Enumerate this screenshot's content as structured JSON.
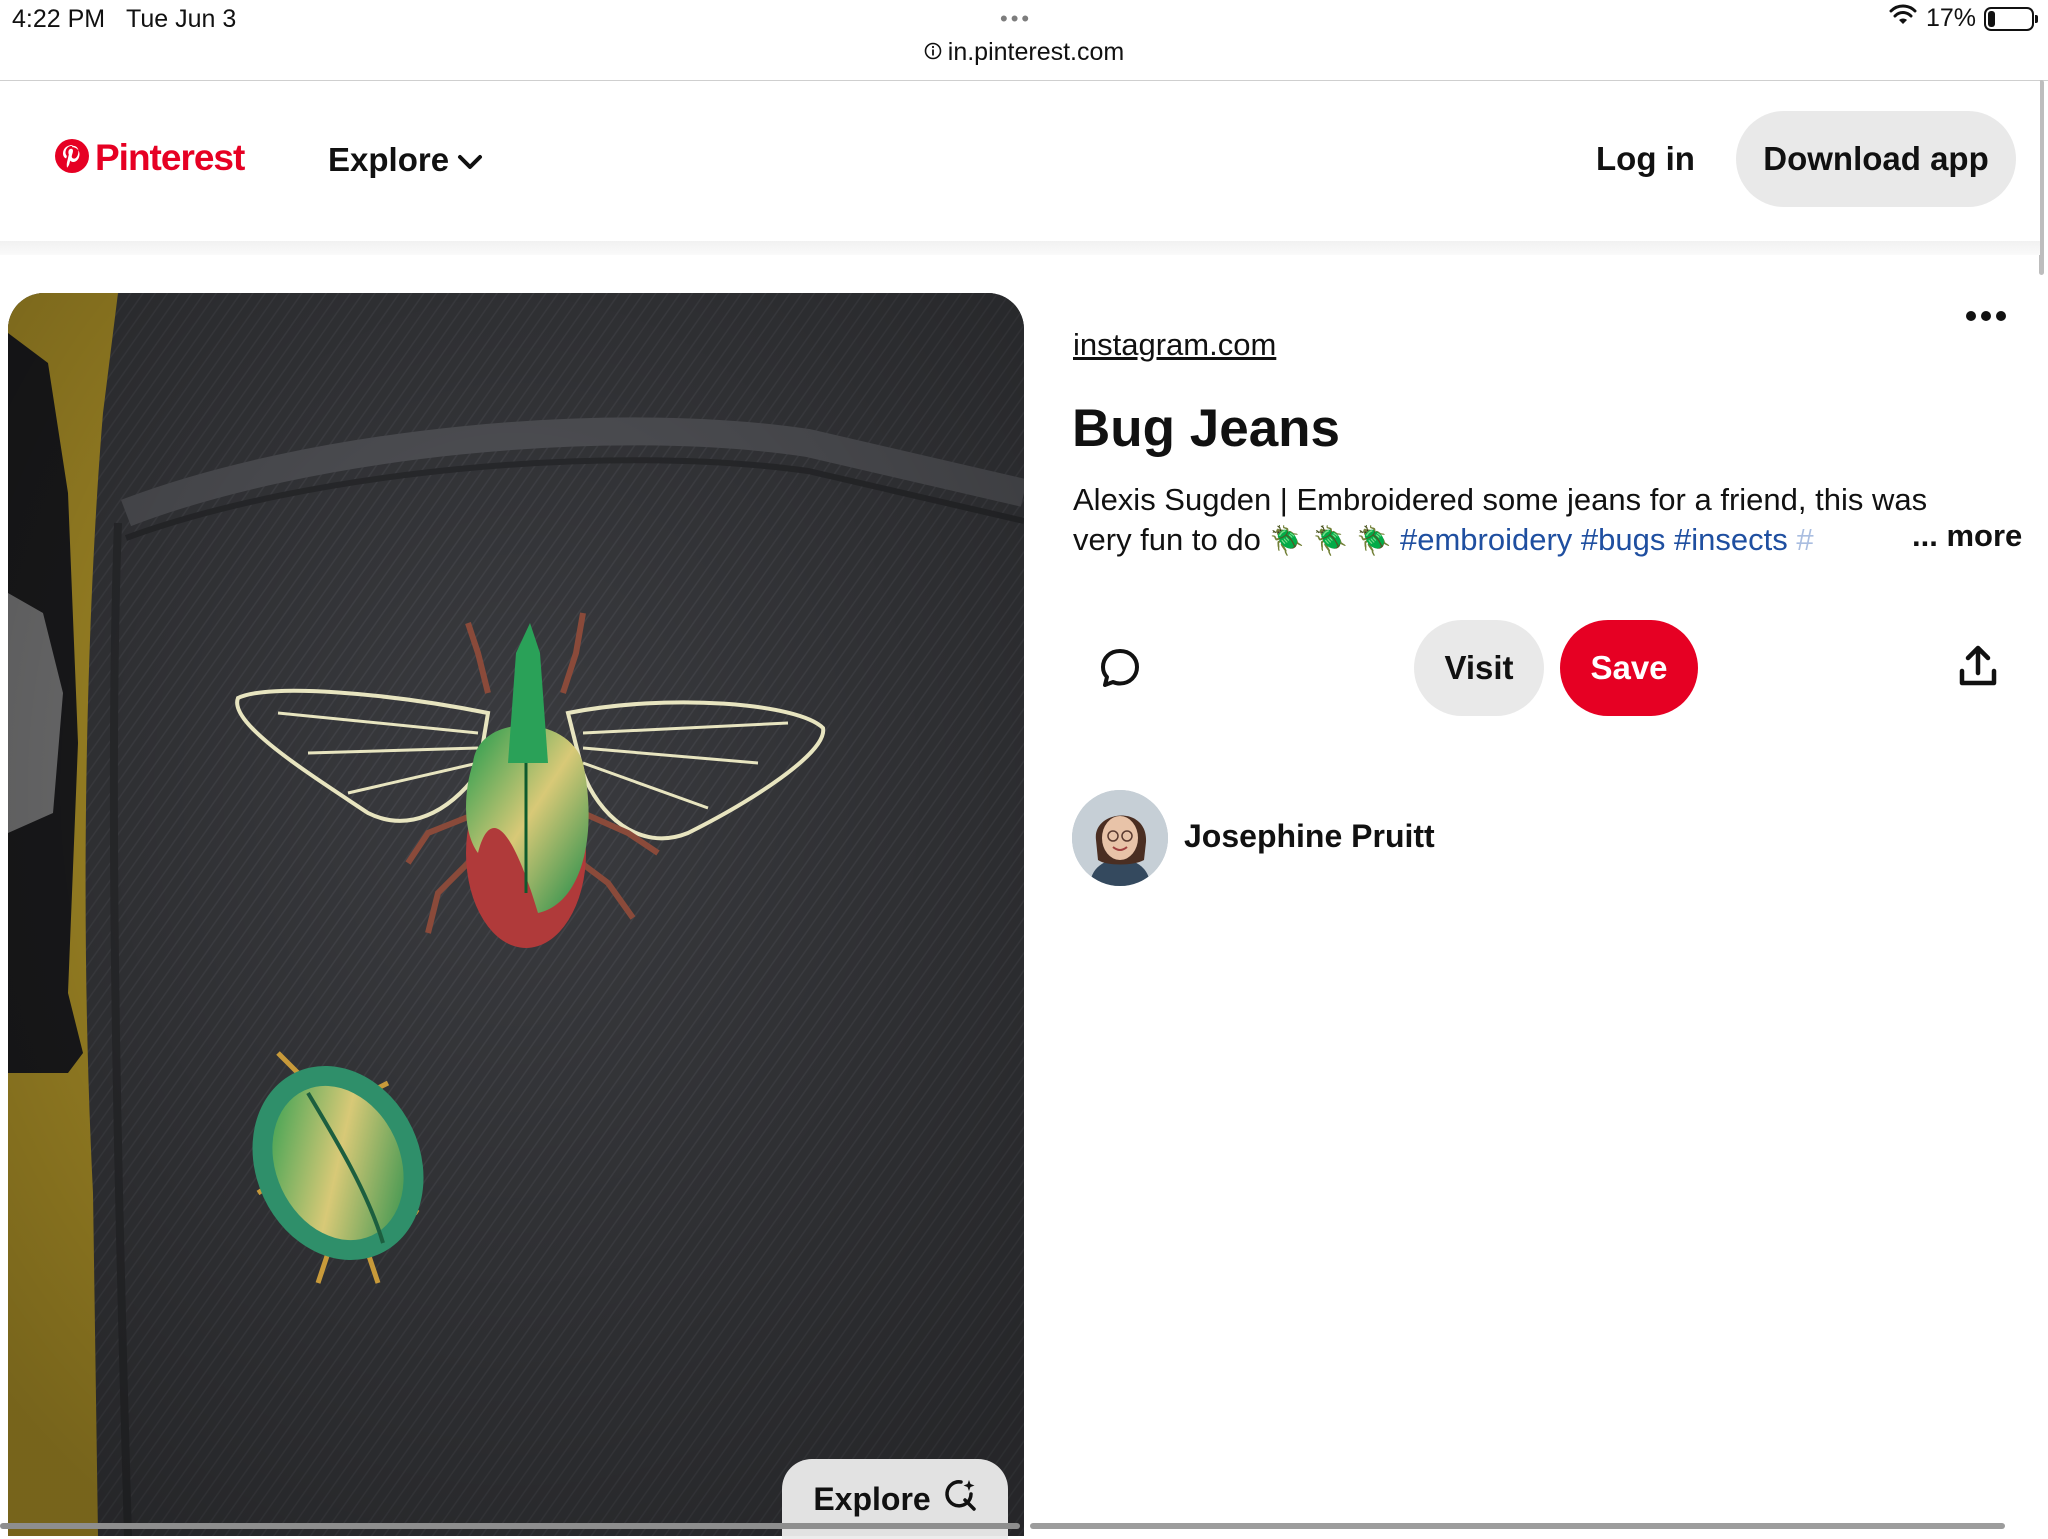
{
  "status_bar": {
    "time": "4:22 PM",
    "date": "Tue Jun 3",
    "battery_percent": "17%",
    "battery_level": 0.17,
    "icons": [
      "wifi-icon",
      "battery-icon"
    ]
  },
  "browser": {
    "url": "in.pinterest.com"
  },
  "header": {
    "logo_text": "Pinterest",
    "explore_label": "Explore",
    "login_label": "Log in",
    "download_label": "Download app"
  },
  "pin": {
    "source": "instagram.com",
    "title": "Bug Jeans",
    "description_line1": "Alexis Sugden | Embroidered some jeans for a friend, this was",
    "description_line2_text": "very fun to do",
    "beetle_emoji": "🪲",
    "hashtags": [
      "#embroidery",
      "#bugs",
      "#insects",
      "#"
    ],
    "more_label": "... more",
    "explore_chip_label": "Explore",
    "actions": {
      "visit_label": "Visit",
      "save_label": "Save"
    },
    "author": {
      "name": "Josephine Pruitt"
    }
  },
  "colors": {
    "brand_red": "#e60023",
    "button_gray": "#e9e9e9",
    "hashtag_blue": "#1f4fa0",
    "denim": "#3a3b3e",
    "mustard": "#b99a2a"
  }
}
